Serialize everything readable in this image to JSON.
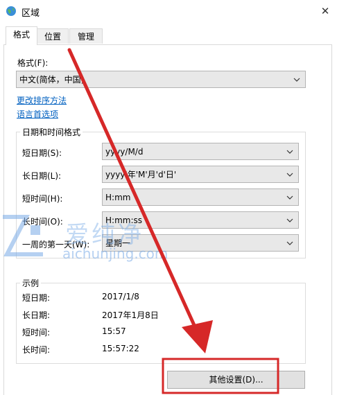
{
  "window": {
    "title": "区域",
    "close_glyph": "✕"
  },
  "tabs": [
    {
      "label": "格式"
    },
    {
      "label": "位置"
    },
    {
      "label": "管理"
    }
  ],
  "format": {
    "label": "格式(F):",
    "value": "中文(简体，中国)",
    "link_sort": "更改排序方法",
    "link_lang": "语言首选项"
  },
  "datetime": {
    "title": "日期和时间格式",
    "rows": [
      {
        "label": "短日期(S):",
        "value": "yyyy/M/d"
      },
      {
        "label": "长日期(L):",
        "value": "yyyy'年'M'月'd'日'"
      },
      {
        "label": "短时间(H):",
        "value": "H:mm"
      },
      {
        "label": "长时间(O):",
        "value": "H:mm:ss"
      },
      {
        "label": "一周的第一天(W):",
        "value": "星期一"
      }
    ]
  },
  "examples": {
    "title": "示例",
    "rows": [
      {
        "label": "短日期:",
        "value": "2017/1/8"
      },
      {
        "label": "长日期:",
        "value": "2017年1月8日"
      },
      {
        "label": "短时间:",
        "value": "15:57"
      },
      {
        "label": "长时间:",
        "value": "15:57:22"
      }
    ]
  },
  "buttons": {
    "more_settings": "其他设置(D)..."
  },
  "watermark": {
    "cn": "爱纯净",
    "url": "aichunjing.com"
  },
  "colors": {
    "link": "#0060c0",
    "annotation": "#d62828",
    "watermark": "#78aae6"
  }
}
